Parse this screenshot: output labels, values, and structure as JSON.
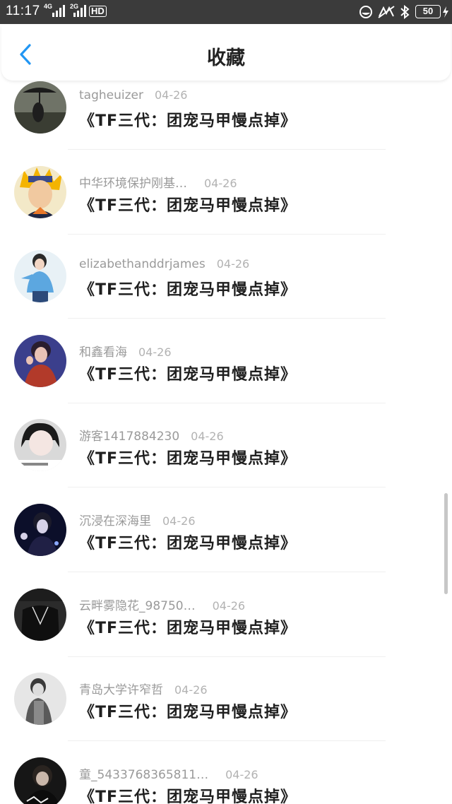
{
  "status_bar": {
    "time": "11:17",
    "network_1": "4G",
    "network_2": "2G",
    "hd_label": "HD",
    "battery": "50"
  },
  "header": {
    "title": "收藏",
    "accent_color": "#2196f3"
  },
  "list": {
    "items": [
      {
        "user": "tagheuizer",
        "date": "04-26",
        "title": "《TF三代：团宠马甲慢点掉》"
      },
      {
        "user": "中华环境保护刚基…",
        "date": "04-26",
        "title": "《TF三代：团宠马甲慢点掉》"
      },
      {
        "user": "elizabethanddrjames",
        "date": "04-26",
        "title": "《TF三代：团宠马甲慢点掉》"
      },
      {
        "user": "和鑫看海",
        "date": "04-26",
        "title": "《TF三代：团宠马甲慢点掉》"
      },
      {
        "user": "游客1417884230",
        "date": "04-26",
        "title": "《TF三代：团宠马甲慢点掉》"
      },
      {
        "user": "沉浸在深海里",
        "date": "04-26",
        "title": "《TF三代：团宠马甲慢点掉》"
      },
      {
        "user": "云畔雾隐花_98750…",
        "date": "04-26",
        "title": "《TF三代：团宠马甲慢点掉》"
      },
      {
        "user": "青岛大学许窄哲",
        "date": "04-26",
        "title": "《TF三代：团宠马甲慢点掉》"
      },
      {
        "user": "童_5433768365811…",
        "date": "04-26",
        "title": "《TF三代：团宠马甲慢点掉》"
      }
    ]
  }
}
